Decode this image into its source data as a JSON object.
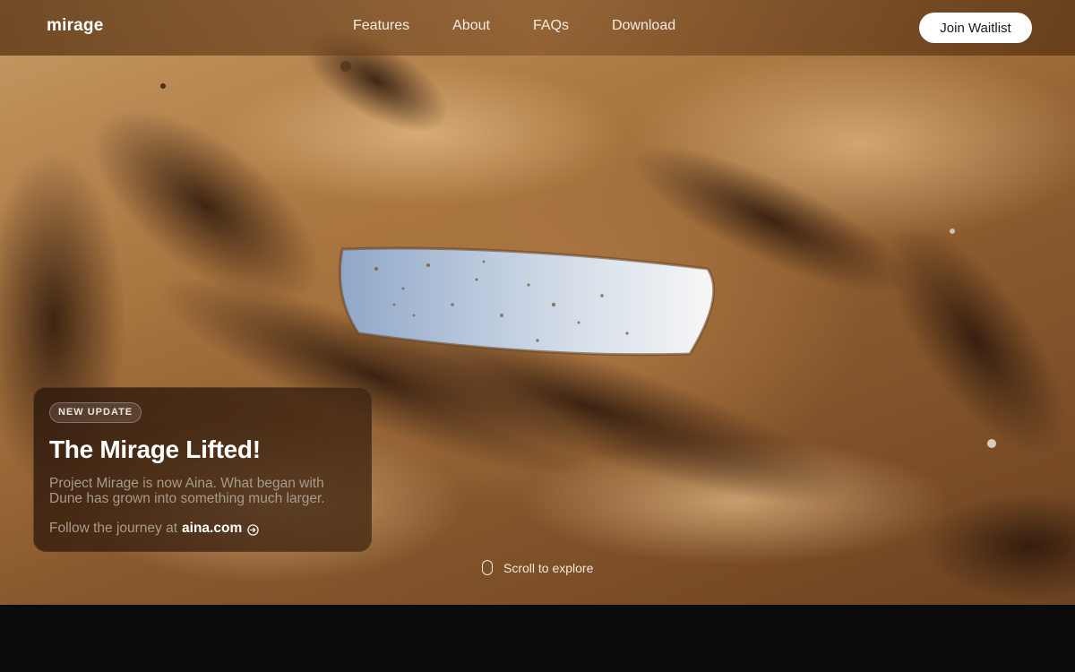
{
  "header": {
    "logo": "mirage",
    "nav": [
      "Features",
      "About",
      "FAQs",
      "Download"
    ],
    "cta": "Join Waitlist"
  },
  "card": {
    "badge": "NEW UPDATE",
    "title": "The Mirage Lifted!",
    "description": "Project Mirage is now Aina. What began with Dune has grown into something much larger.",
    "follow_prefix": "Follow the journey at",
    "link": "aina.com",
    "link_icon": "arrow-right-circle-icon"
  },
  "scroll_hint": {
    "icon": "mouse-icon",
    "label": "Scroll to explore"
  },
  "colors": {
    "header_bg": "#5a3614",
    "cta_bg": "#ffffff",
    "card_bg": "#3a2212",
    "footer_bg": "#0b0b0c"
  }
}
